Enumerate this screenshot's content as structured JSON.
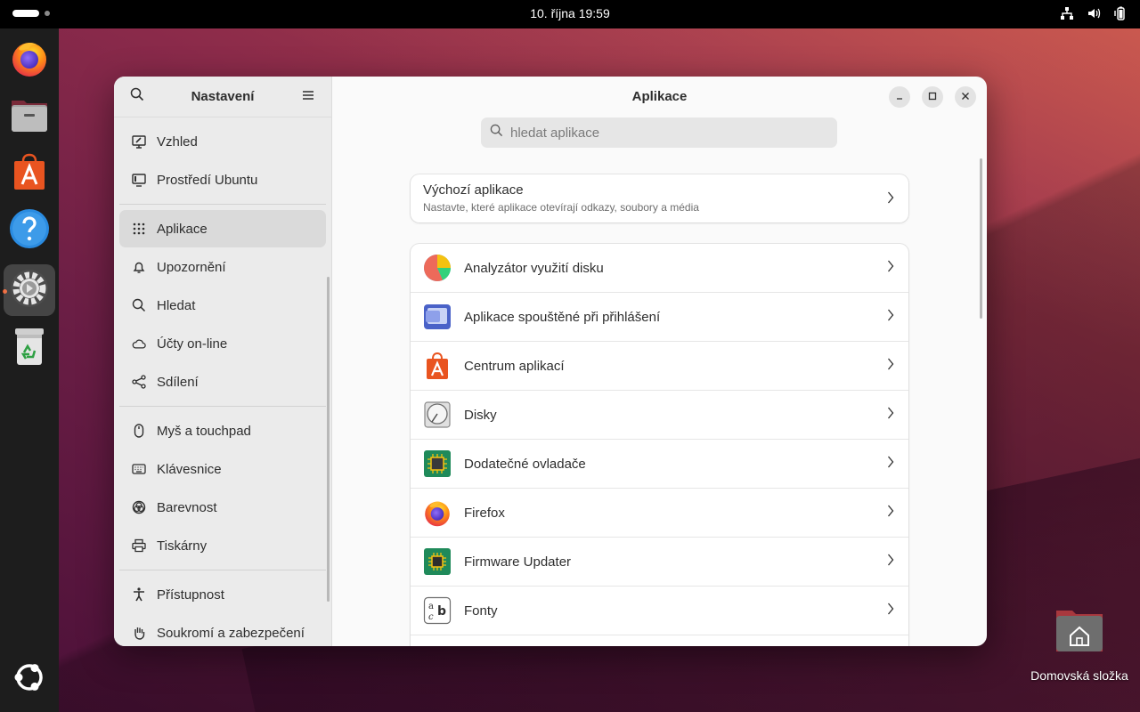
{
  "topbar": {
    "clock": "10. října  19:59",
    "tray_icons": [
      "network-icon",
      "volume-icon",
      "battery-icon"
    ]
  },
  "dock": {
    "items": [
      {
        "name": "firefox"
      },
      {
        "name": "files"
      },
      {
        "name": "app-center"
      },
      {
        "name": "help"
      },
      {
        "name": "settings",
        "active": true
      },
      {
        "name": "trash"
      },
      {
        "name": "show-apps"
      }
    ]
  },
  "desktop": {
    "home_label": "Domovská složka"
  },
  "sidebar": {
    "title": "Nastavení",
    "items": [
      {
        "label": "Vzhled",
        "icon": "appearance-icon"
      },
      {
        "label": "Prostředí Ubuntu",
        "icon": "ubuntu-desktop-icon"
      },
      {
        "label": "Aplikace",
        "icon": "apps-grid-icon",
        "selected": true
      },
      {
        "label": "Upozornění",
        "icon": "bell-icon"
      },
      {
        "label": "Hledat",
        "icon": "search-icon"
      },
      {
        "label": "Účty on-line",
        "icon": "cloud-icon"
      },
      {
        "label": "Sdílení",
        "icon": "share-icon"
      },
      {
        "label": "Myš a touchpad",
        "icon": "mouse-icon"
      },
      {
        "label": "Klávesnice",
        "icon": "keyboard-icon"
      },
      {
        "label": "Barevnost",
        "icon": "color-icon"
      },
      {
        "label": "Tiskárny",
        "icon": "printer-icon"
      },
      {
        "label": "Přístupnost",
        "icon": "accessibility-icon"
      },
      {
        "label": "Soukromí a zabezpečení",
        "icon": "hand-icon"
      }
    ]
  },
  "main": {
    "title": "Aplikace",
    "search_placeholder": "hledat aplikace",
    "default_apps": {
      "title": "Výchozí aplikace",
      "subtitle": "Nastavte, které aplikace otevírají odkazy, soubory a média"
    },
    "apps": [
      {
        "label": "Analyzátor využití disku",
        "icon": "disk-usage-icon"
      },
      {
        "label": "Aplikace spouštěné při přihlášení",
        "icon": "startup-apps-icon"
      },
      {
        "label": "Centrum aplikací",
        "icon": "app-center-icon"
      },
      {
        "label": "Disky",
        "icon": "disks-icon"
      },
      {
        "label": "Dodatečné ovladače",
        "icon": "drivers-icon"
      },
      {
        "label": "Firefox",
        "icon": "firefox-icon"
      },
      {
        "label": "Firmware Updater",
        "icon": "firmware-icon"
      },
      {
        "label": "Fonty",
        "icon": "fonts-icon"
      }
    ]
  },
  "colors": {
    "accent": "#e95420",
    "sidebar_bg": "#ebebeb",
    "content_bg": "#fafafa"
  }
}
